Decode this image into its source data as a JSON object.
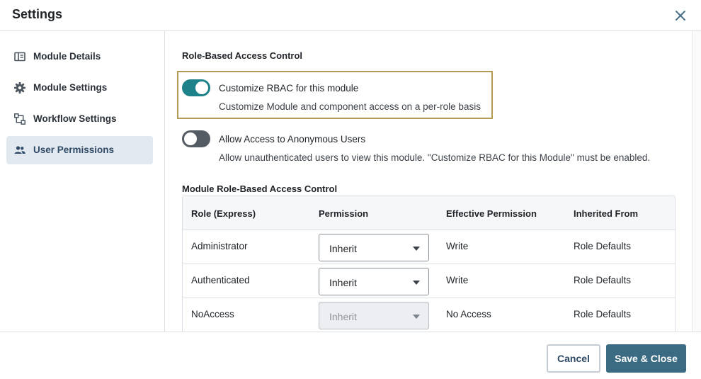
{
  "dialog": {
    "title": "Settings"
  },
  "sidebar": {
    "items": [
      {
        "label": "Module Details",
        "icon": "module-details-icon",
        "active": false
      },
      {
        "label": "Module Settings",
        "icon": "gear-icon",
        "active": false
      },
      {
        "label": "Workflow Settings",
        "icon": "workflow-icon",
        "active": false
      },
      {
        "label": "User Permissions",
        "icon": "users-icon",
        "active": true
      }
    ]
  },
  "rbac": {
    "section_title": "Role-Based Access Control",
    "customize": {
      "label": "Customize RBAC for this module",
      "description": "Customize Module and component access on a per-role basis",
      "enabled": true
    },
    "anonymous": {
      "label": "Allow Access to Anonymous Users",
      "description": "Allow unauthenticated users to view this module. \"Customize RBAC for this Module\" must be enabled.",
      "enabled": false
    }
  },
  "module_rbac": {
    "section_title": "Module Role-Based Access Control",
    "columns": [
      "Role (Express)",
      "Permission",
      "Effective Permission",
      "Inherited From"
    ],
    "rows": [
      {
        "role": "Administrator",
        "permission": "Inherit",
        "effective": "Write",
        "inherited_from": "Role Defaults",
        "disabled": false
      },
      {
        "role": "Authenticated",
        "permission": "Inherit",
        "effective": "Write",
        "inherited_from": "Role Defaults",
        "disabled": false
      },
      {
        "role": "NoAccess",
        "permission": "Inherit",
        "effective": "No Access",
        "inherited_from": "Role Defaults",
        "disabled": true
      }
    ]
  },
  "footer": {
    "cancel_label": "Cancel",
    "save_label": "Save & Close"
  },
  "colors": {
    "toggle_on": "#1d8189",
    "toggle_off": "#555b62",
    "primary_button": "#3b6b82",
    "highlight_border": "#b39a55",
    "active_nav": "#e3e9f0"
  }
}
